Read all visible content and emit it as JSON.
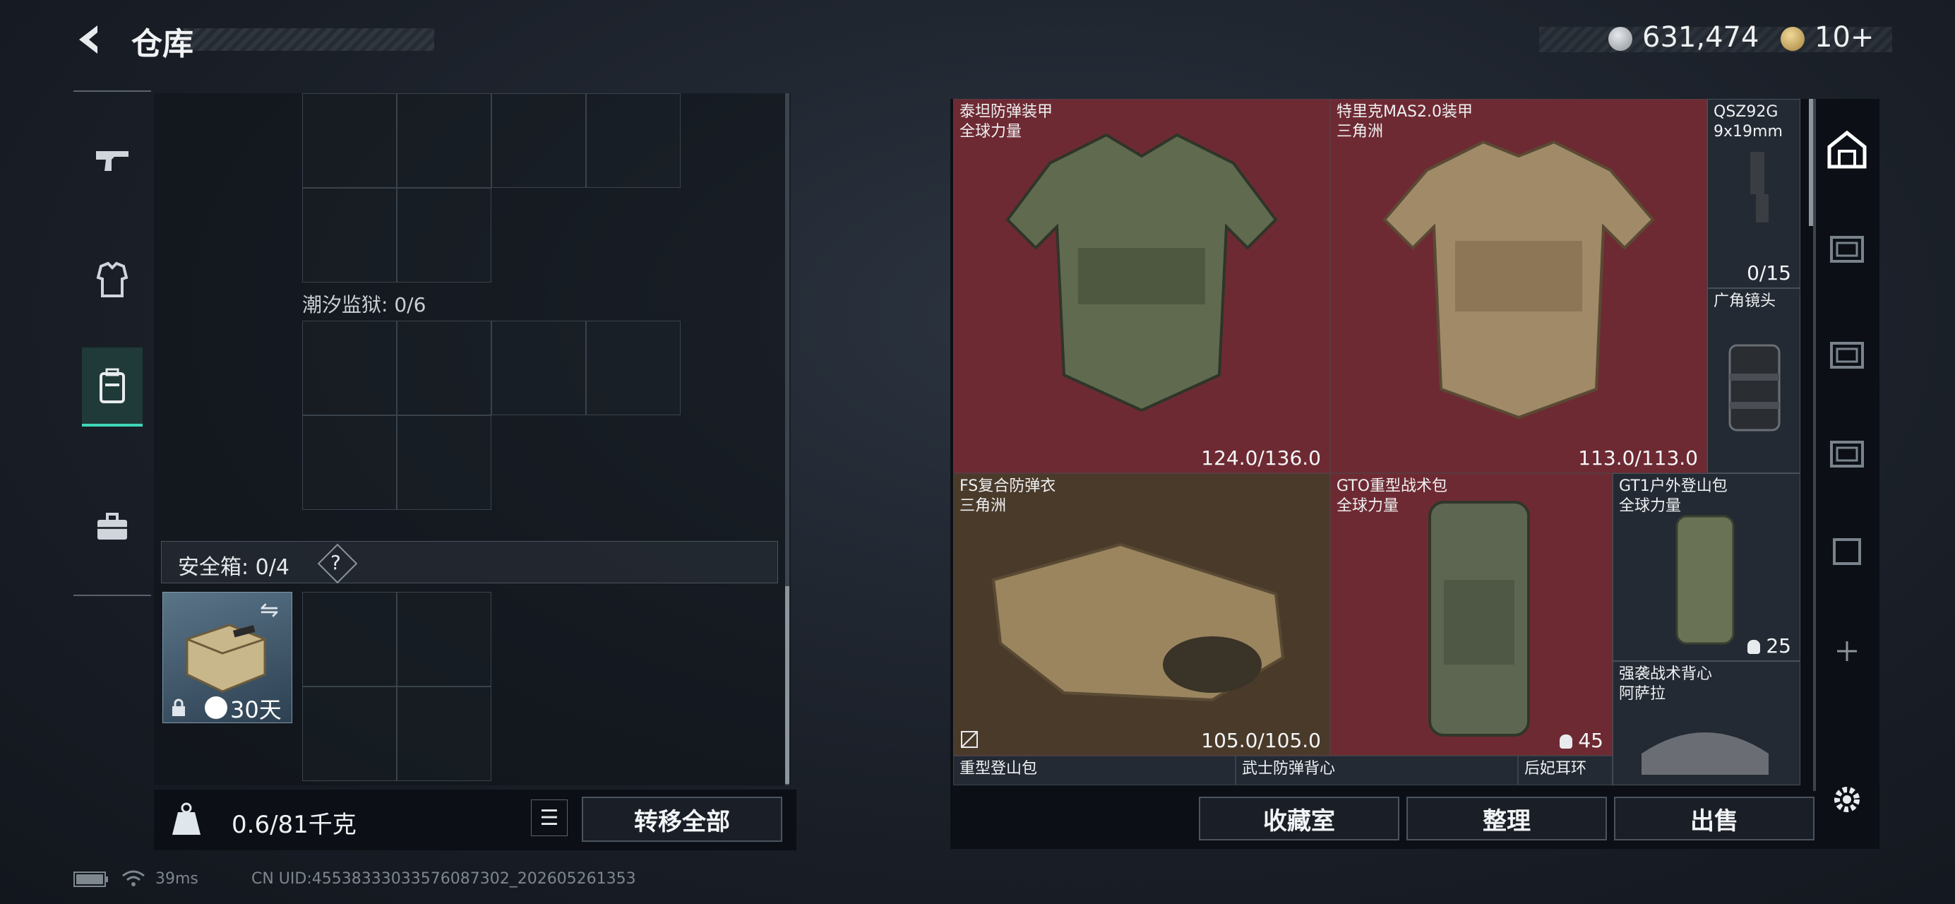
{
  "header": {
    "title": "仓库",
    "currency_silver": "631,474",
    "currency_gold": "10+"
  },
  "left": {
    "prison_label": "潮汐监狱: 0/6",
    "safe_label": "安全箱: 0/4",
    "help": "?",
    "safebox_days": "30天",
    "weight_value": "0.6/81千克",
    "transfer_all": "转移全部",
    "swap_glyph": "⇋",
    "lock_glyph": "🔒"
  },
  "status": {
    "ping": "39ms",
    "uid": "CN UID:4553833303357608730​2_202605261353"
  },
  "items": [
    {
      "name": "泰坦防弹装甲",
      "sub": "全球力量",
      "durability": "124.0/136.0"
    },
    {
      "name": "特里克MAS2.0装甲",
      "sub": "三角洲",
      "durability": "113.0/113.0"
    },
    {
      "name": "QSZ92G",
      "sub": "9x19mm",
      "durability": "0/15"
    },
    {
      "name": "广角镜头",
      "sub": "",
      "durability": ""
    },
    {
      "name": "FS复合防弹衣",
      "sub": "三角洲",
      "durability": "105.0/105.0"
    },
    {
      "name": "GTO重型战术包",
      "sub": "全球力量",
      "durability": "45"
    },
    {
      "name": "GT1户外登山包",
      "sub": "全球力量",
      "durability": "25"
    },
    {
      "name": "强袭战术背心",
      "sub": "阿萨拉",
      "durability": ""
    },
    {
      "name": "重型登山包",
      "sub": "",
      "durability": ""
    },
    {
      "name": "武士防弹背心",
      "sub": "",
      "durability": ""
    },
    {
      "name": "后妃耳环",
      "sub": "",
      "durability": ""
    }
  ],
  "buttons": {
    "collection": "收藏室",
    "organize": "整理",
    "sell": "出售"
  },
  "colors": {
    "accent": "#3fd7b8",
    "item_red": "#6e2a33"
  },
  "icons": [
    "back-arrow-icon",
    "silver-coin-icon",
    "gold-coin-icon",
    "pistol-icon",
    "armor-icon",
    "backpack-icon",
    "briefcase-icon",
    "kg-weight-icon",
    "list-icon",
    "settings-gear-icon",
    "plus-icon"
  ]
}
